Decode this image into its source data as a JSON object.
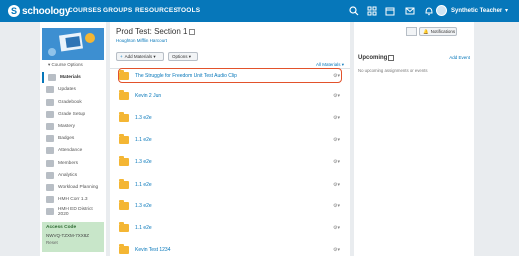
{
  "nav": {
    "logo_letter": "S",
    "logo_text": "schoology",
    "items": [
      "COURSES",
      "GROUPS",
      "RESOURCES",
      "TOOLS"
    ],
    "user_name": "Synthetic Teacher",
    "icons": [
      "search-icon",
      "grid-icon",
      "calendar-icon",
      "mail-icon",
      "bell-icon",
      "avatar"
    ]
  },
  "sidebar": {
    "course_options": "▾ Course Options",
    "items": [
      {
        "label": "Materials",
        "active": true
      },
      {
        "label": "Updates"
      },
      {
        "label": "Gradebook"
      },
      {
        "label": "Grade Setup"
      },
      {
        "label": "Mastery"
      },
      {
        "label": "Badges"
      },
      {
        "label": "Attendance"
      },
      {
        "label": "Members"
      },
      {
        "label": "Analytics"
      },
      {
        "label": "Workload Planning"
      },
      {
        "label": "HMH Corr 1.3"
      },
      {
        "label": "HMH ED District 2020"
      }
    ],
    "access": {
      "title": "Access Code",
      "code": "NWVQ-TZXM-7XX8Z",
      "reset": "Reset"
    }
  },
  "main": {
    "title": "Prod Test: Section 1",
    "subtitle": "Houghton Mifflin Harcourt",
    "add_materials": "Add Materials ▾",
    "options": "Options ▾",
    "all_materials": "All Materials ▾",
    "rows": [
      {
        "label": "The Struggle for Freedom Unit Test Audio Clip",
        "highlighted": true
      },
      {
        "label": "Kevin 2 Jun"
      },
      {
        "label": "1.3 e2e"
      },
      {
        "label": "1.1 e2e"
      },
      {
        "label": "1.3 e2e"
      },
      {
        "label": "1.1 e2e"
      },
      {
        "label": "1.3 e2e"
      },
      {
        "label": "1.1 e2e"
      },
      {
        "label": "Kevin Test 1234"
      }
    ]
  },
  "right": {
    "notifications": "Notifications",
    "upcoming_title": "Upcoming",
    "add_event": "Add Event",
    "no_upcoming": "No upcoming assignments or events"
  },
  "colors": {
    "brand_blue": "#0677ba",
    "highlight_red": "#e2522b",
    "folder_yellow": "#f4b634",
    "access_green": "#c8e6c9"
  }
}
